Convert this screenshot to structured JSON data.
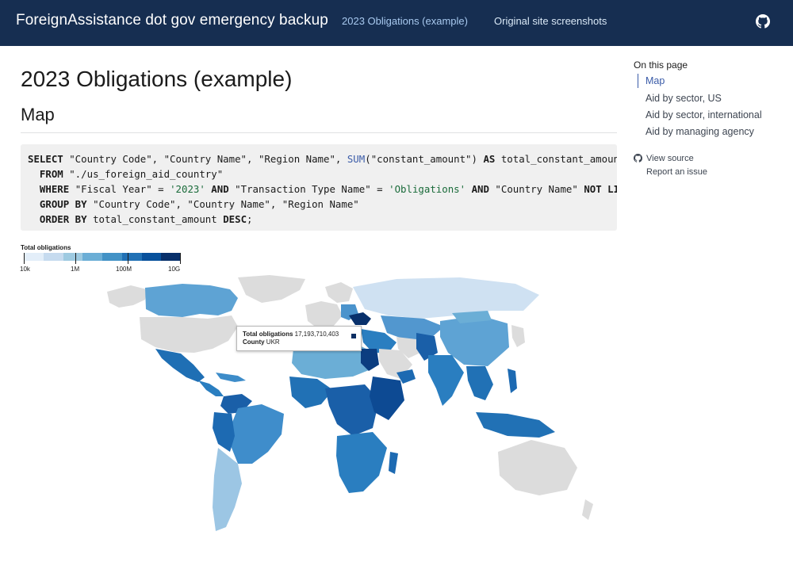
{
  "header": {
    "site_title": "ForeignAssistance dot gov emergency backup",
    "nav": [
      {
        "label": "2023 Obligations (example)"
      },
      {
        "label": "Original site screenshots"
      }
    ],
    "github_icon": "github-icon"
  },
  "main": {
    "title": "2023 Obligations (example)",
    "section_title": "Map",
    "code_lines": [
      "SELECT \"Country Code\", \"Country Name\", \"Region Name\", SUM(\"constant_amount\") AS total_constant_amount",
      "  FROM \"./us_foreign_aid_country\"",
      "  WHERE \"Fiscal Year\" = '2023' AND \"Transaction Type Name\" = 'Obligations' AND \"Country Name\" NOT LIKE '%Regi",
      "  GROUP BY \"Country Code\", \"Country Name\", \"Region Name\"",
      "  ORDER BY total_constant_amount DESC;"
    ],
    "legend": {
      "title": "Total obligations",
      "ticks": [
        "10k",
        "1M",
        "100M",
        "10G"
      ],
      "colors": [
        "#e3eef9",
        "#c6dbef",
        "#9ecae1",
        "#6baed6",
        "#4292c6",
        "#2171b5",
        "#08519c",
        "#08306b"
      ]
    },
    "tooltip": {
      "value_label": "Total obligations",
      "value": "17,193,710,403",
      "country_label": "County",
      "country": "UKR"
    }
  },
  "toc": {
    "heading": "On this page",
    "items": [
      {
        "label": "Map"
      },
      {
        "label": "Aid by sector, US"
      },
      {
        "label": "Aid by sector, international"
      },
      {
        "label": "Aid by managing agency"
      }
    ],
    "view_source": "View source",
    "report_issue": "Report an issue"
  }
}
